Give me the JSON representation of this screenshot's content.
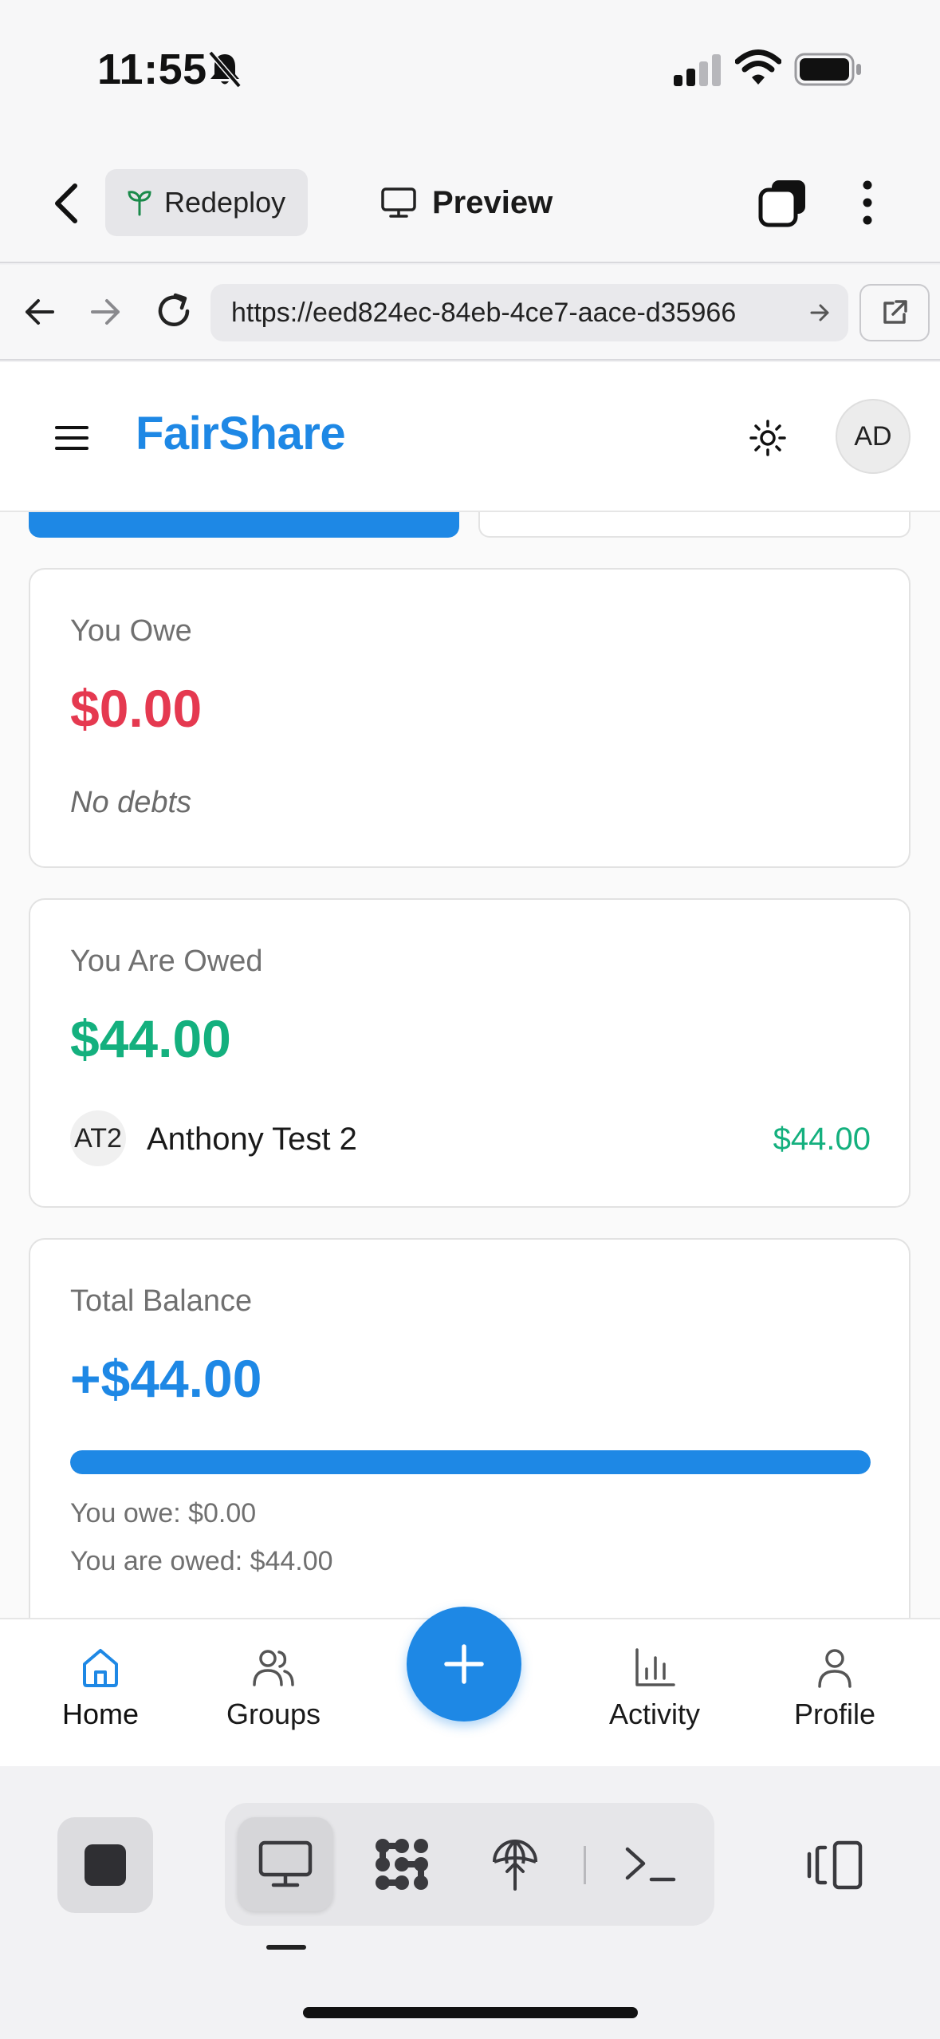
{
  "status_bar": {
    "time": "11:55"
  },
  "header": {
    "redeploy_label": "Redeploy",
    "preview_label": "Preview"
  },
  "browser": {
    "url": "https://eed824ec-84eb-4ce7-aace-d35966"
  },
  "app": {
    "brand": "FairShare",
    "avatar_initials": "AD"
  },
  "owe_card": {
    "label": "You Owe",
    "amount": "$0.00",
    "empty_text": "No debts"
  },
  "owed_card": {
    "label": "You Are Owed",
    "amount": "$44.00",
    "debtors": [
      {
        "initials": "AT2",
        "name": "Anthony Test 2",
        "amount": "$44.00"
      }
    ]
  },
  "total_card": {
    "label": "Total Balance",
    "amount": "+$44.00",
    "owed_share": 1.0,
    "owe_line": "You owe: $0.00",
    "owed_line": "You are owed: $44.00"
  },
  "tabbar": {
    "home": "Home",
    "groups": "Groups",
    "activity": "Activity",
    "profile": "Profile",
    "fab_icon": "plus-icon"
  },
  "colors": {
    "accent": "#1e88e5",
    "negative": "#e53950",
    "positive": "#14b07e"
  }
}
